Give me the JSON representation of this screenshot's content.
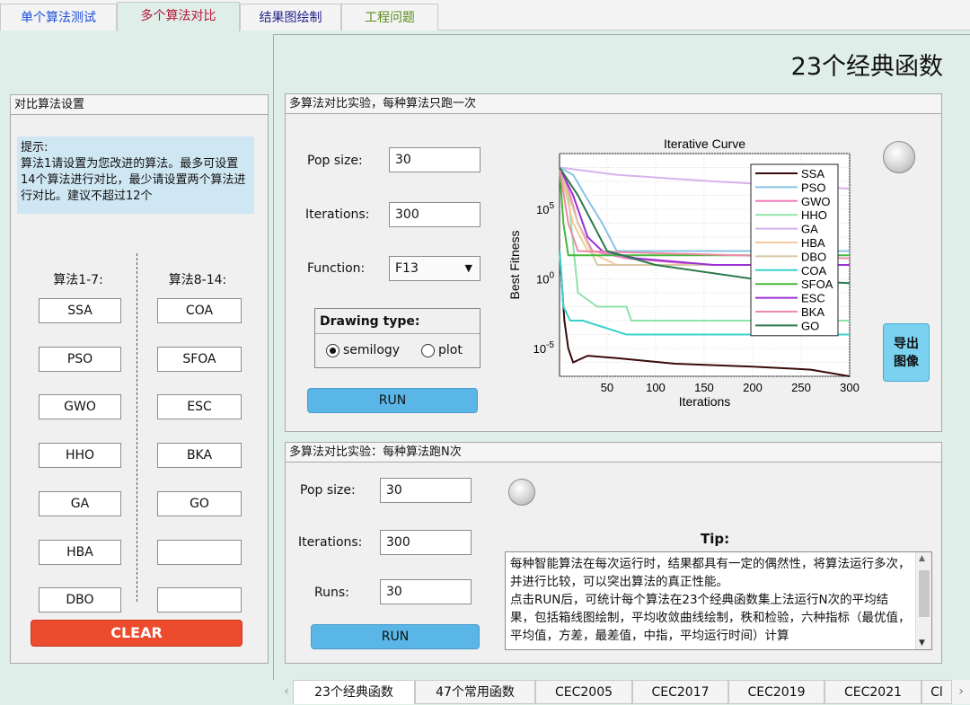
{
  "top_tabs": [
    "单个算法测试",
    "多个算法对比",
    "结果图绘制",
    "工程问题"
  ],
  "top_tab_colors": [
    "#1f4fd6",
    "#b5173a",
    "#1f1f8a",
    "#5a8a1a"
  ],
  "page_title": "23个经典函数",
  "left_panel": {
    "title": "对比算法设置",
    "tip": "提示:\n算法1请设置为您改进的算法。最多可设置14个算法进行对比，最少请设置两个算法进行对比。建议不超过12个",
    "col1_header": "算法1-7:",
    "col2_header": "算法8-14:",
    "col1": [
      "SSA",
      "PSO",
      "GWO",
      "HHO",
      "GA",
      "HBA",
      "DBO"
    ],
    "col2": [
      "COA",
      "SFOA",
      "ESC",
      "BKA",
      "GO",
      "",
      ""
    ],
    "clear_label": "CLEAR"
  },
  "single_run_panel": {
    "title": "多算法对比实验，每种算法只跑一次",
    "pop_size_label": "Pop size:",
    "pop_size_value": "30",
    "iterations_label": "Iterations:",
    "iterations_value": "300",
    "function_label": "Function:",
    "function_value": "F13",
    "drawing_type_label": "Drawing type:",
    "option_semilogy": "semilogy",
    "option_plot": "plot",
    "selected_option": "semilogy",
    "run_label": "RUN",
    "export_label": "导出图像"
  },
  "multi_run_panel": {
    "title": "多算法对比实验：每种算法跑N次",
    "pop_size_label": "Pop size:",
    "pop_size_value": "30",
    "iterations_label": "Iterations:",
    "iterations_value": "300",
    "runs_label": "Runs:",
    "runs_value": "30",
    "run_label": "RUN",
    "tip_title": "Tip:",
    "tip_text": "每种智能算法在每次运行时，结果都具有一定的偶然性，将算法运行多次，并进行比较，可以突出算法的真正性能。\n点击RUN后，可统计每个算法在23个经典函数集上法运行N次的平均结果，包括箱线图绘制，平均收敛曲线绘制，秩和检验，六种指标（最优值，平均值，方差，最差值，中指，平均运行时间）计算"
  },
  "bottom_tabs": [
    "23个经典函数",
    "47个常用函数",
    "CEC2005",
    "CEC2017",
    "CEC2019",
    "CEC2021",
    "Cl"
  ],
  "chart_data": {
    "type": "line",
    "title": "Iterative Curve",
    "xlabel": "Iterations",
    "ylabel": "Best Fitness",
    "yscale": "log",
    "xlim": [
      1,
      300
    ],
    "ylim": [
      1e-07,
      1000000000.0
    ],
    "x_ticks": [
      "50",
      "100",
      "150",
      "200",
      "250",
      "300"
    ],
    "y_tick_exponents": [
      -5,
      0,
      5
    ],
    "legend_position": "top-right",
    "series": [
      {
        "name": "SSA",
        "color": "#3a0a0a",
        "points": [
          [
            1,
            100.0
          ],
          [
            6,
            0.001
          ],
          [
            10,
            1e-05
          ],
          [
            15,
            1e-06
          ],
          [
            30,
            3e-06
          ],
          [
            60,
            2e-06
          ],
          [
            120,
            8e-07
          ],
          [
            200,
            5e-07
          ],
          [
            260,
            3e-07
          ],
          [
            300,
            1e-07
          ]
        ]
      },
      {
        "name": "PSO",
        "color": "#87c4e6",
        "points": [
          [
            1,
            100000000.0
          ],
          [
            15,
            30000000.0
          ],
          [
            30,
            500000.0
          ],
          [
            45,
            10000.0
          ],
          [
            60,
            100.0
          ],
          [
            80,
            100.0
          ],
          [
            300,
            100.0
          ]
        ]
      },
      {
        "name": "GWO",
        "color": "#f27bbd",
        "points": [
          [
            1,
            100000000.0
          ],
          [
            12,
            1000000.0
          ],
          [
            20,
            10000.0
          ],
          [
            35,
            100.0
          ],
          [
            70,
            30.0
          ],
          [
            150,
            10.0
          ],
          [
            300,
            10.0
          ]
        ]
      },
      {
        "name": "HHO",
        "color": "#8de3a8",
        "points": [
          [
            1,
            100000000.0
          ],
          [
            10,
            1000000.0
          ],
          [
            20,
            0.1
          ],
          [
            40,
            0.01
          ],
          [
            70,
            0.01
          ],
          [
            75,
            0.001
          ],
          [
            300,
            0.001
          ]
        ]
      },
      {
        "name": "GA",
        "color": "#d7b3ec",
        "points": [
          [
            1,
            100000000.0
          ],
          [
            60,
            30000000.0
          ],
          [
            160,
            10000000.0
          ],
          [
            300,
            3000000.0
          ]
        ]
      },
      {
        "name": "HBA",
        "color": "#f5c99a",
        "points": [
          [
            1,
            100000000.0
          ],
          [
            15,
            10000.0
          ],
          [
            30,
            100.0
          ],
          [
            60,
            10.0
          ],
          [
            300,
            10.0
          ]
        ]
      },
      {
        "name": "DBO",
        "color": "#d8c7a2",
        "points": [
          [
            1,
            100000000.0
          ],
          [
            20,
            10000.0
          ],
          [
            40,
            10.0
          ],
          [
            300,
            10.0
          ]
        ]
      },
      {
        "name": "COA",
        "color": "#39d1cc",
        "points": [
          [
            1,
            100.0
          ],
          [
            5,
            0.01
          ],
          [
            12,
            0.001
          ],
          [
            25,
            0.001
          ],
          [
            70,
            0.0001
          ],
          [
            300,
            0.0001
          ]
        ]
      },
      {
        "name": "SFOA",
        "color": "#46b83c",
        "points": [
          [
            1,
            100000000.0
          ],
          [
            5,
            10000.0
          ],
          [
            10,
            50.0
          ],
          [
            300,
            50.0
          ]
        ]
      },
      {
        "name": "ESC",
        "color": "#9b2fd6",
        "points": [
          [
            1,
            100000000.0
          ],
          [
            15,
            1000000.0
          ],
          [
            30,
            1000.0
          ],
          [
            45,
            100.0
          ],
          [
            80,
            30.0
          ],
          [
            160,
            10.0
          ],
          [
            300,
            10.0
          ]
        ]
      },
      {
        "name": "BKA",
        "color": "#f08aa8",
        "points": [
          [
            1,
            100000000.0
          ],
          [
            10,
            10000.0
          ],
          [
            20,
            100.0
          ],
          [
            300,
            30.0
          ]
        ]
      },
      {
        "name": "GO",
        "color": "#2b7a4b",
        "points": [
          [
            1,
            100000000.0
          ],
          [
            20,
            1000000.0
          ],
          [
            35,
            10000.0
          ],
          [
            50,
            100.0
          ],
          [
            100,
            10.0
          ],
          [
            200,
            1.0
          ],
          [
            300,
            0.5
          ]
        ]
      }
    ]
  }
}
